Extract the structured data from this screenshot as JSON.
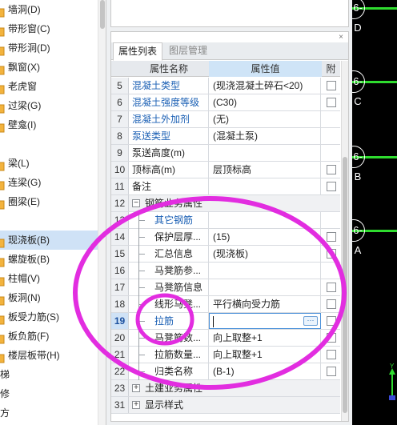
{
  "left_tree": {
    "items": [
      {
        "label": "墙洞(D)",
        "top_level": false,
        "selected": false
      },
      {
        "label": "带形窗(C)",
        "top_level": false,
        "selected": false
      },
      {
        "label": "带形洞(D)",
        "top_level": false,
        "selected": false
      },
      {
        "label": "飘窗(X)",
        "top_level": false,
        "selected": false
      },
      {
        "label": "老虎窗",
        "top_level": false,
        "selected": false
      },
      {
        "label": "过梁(G)",
        "top_level": false,
        "selected": false
      },
      {
        "label": "壁龛(I)",
        "top_level": false,
        "selected": false
      },
      {
        "label": "",
        "top_level": true,
        "selected": false
      },
      {
        "label": "梁(L)",
        "top_level": false,
        "selected": false
      },
      {
        "label": "连梁(G)",
        "top_level": false,
        "selected": false
      },
      {
        "label": "圈梁(E)",
        "top_level": false,
        "selected": false
      },
      {
        "label": "",
        "top_level": true,
        "selected": false
      },
      {
        "label": "现浇板(B)",
        "top_level": false,
        "selected": true
      },
      {
        "label": "螺旋板(B)",
        "top_level": false,
        "selected": false
      },
      {
        "label": "柱帽(V)",
        "top_level": false,
        "selected": false
      },
      {
        "label": "板洞(N)",
        "top_level": false,
        "selected": false
      },
      {
        "label": "板受力筋(S)",
        "top_level": false,
        "selected": false
      },
      {
        "label": "板负筋(F)",
        "top_level": false,
        "selected": false
      },
      {
        "label": "楼层板带(H)",
        "top_level": false,
        "selected": false
      },
      {
        "label": "梯",
        "top_level": true,
        "selected": false
      },
      {
        "label": "修",
        "top_level": true,
        "selected": false
      },
      {
        "label": "方",
        "top_level": true,
        "selected": false
      }
    ]
  },
  "panel": {
    "close_glyph": "×",
    "tabs": [
      {
        "label": "属性列表",
        "active": true
      },
      {
        "label": "图层管理",
        "active": false
      }
    ],
    "columns": {
      "name": "属性名称",
      "value": "属性值",
      "attach": "附"
    },
    "rows": [
      {
        "num": "5",
        "name": "混凝土类型",
        "value": "(现浇混凝土碎石<20)",
        "link": true,
        "check": true
      },
      {
        "num": "6",
        "name": "混凝土强度等级",
        "value": "(C30)",
        "link": true,
        "check": true
      },
      {
        "num": "7",
        "name": "混凝土外加剂",
        "value": "(无)",
        "link": true,
        "check": false
      },
      {
        "num": "8",
        "name": "泵送类型",
        "value": "(混凝土泵)",
        "link": true,
        "check": false
      },
      {
        "num": "9",
        "name": "泵送高度(m)",
        "value": "",
        "link": false,
        "check": false
      },
      {
        "num": "10",
        "name": "顶标高(m)",
        "value": "层顶标高",
        "link": false,
        "check": true
      },
      {
        "num": "11",
        "name": "备注",
        "value": "",
        "link": false,
        "check": true
      },
      {
        "num": "12",
        "name": "钢筋业务属性",
        "value": "",
        "group": true,
        "expander": "−",
        "check": false
      },
      {
        "num": "13",
        "name": "其它钢筋",
        "value": "",
        "link": true,
        "child": true,
        "check": false
      },
      {
        "num": "14",
        "name": "保护层厚...",
        "value": "(15)",
        "link": false,
        "child": true,
        "check": true
      },
      {
        "num": "15",
        "name": "汇总信息",
        "value": "(现浇板)",
        "link": false,
        "child": true,
        "check": true
      },
      {
        "num": "16",
        "name": "马凳筋参...",
        "value": "",
        "link": false,
        "child": true,
        "check": false
      },
      {
        "num": "17",
        "name": "马凳筋信息",
        "value": "",
        "link": false,
        "child": true,
        "check": true
      },
      {
        "num": "18",
        "name": "线形马凳...",
        "value": "平行横向受力筋",
        "link": false,
        "child": true,
        "check": true
      },
      {
        "num": "19",
        "name": "拉筋",
        "value": "",
        "link": true,
        "child": true,
        "check": true,
        "current": true,
        "editing": true,
        "more": "···"
      },
      {
        "num": "20",
        "name": "马凳筋数...",
        "value": "向上取整+1",
        "link": false,
        "child": true,
        "check": true
      },
      {
        "num": "21",
        "name": "拉筋数量...",
        "value": "向上取整+1",
        "link": false,
        "child": true,
        "check": true
      },
      {
        "num": "22",
        "name": "归类名称",
        "value": "(B-1)",
        "link": false,
        "child": true,
        "check": true
      },
      {
        "num": "23",
        "name": "土建业务属性",
        "value": "",
        "group": true,
        "expander": "+",
        "check": false
      },
      {
        "num": "31",
        "name": "显示样式",
        "value": "",
        "group": true,
        "expander": "+",
        "check": false
      }
    ]
  },
  "canvas": {
    "axis_labels": [
      "6-D",
      "6-C",
      "6-B",
      "6-A"
    ],
    "line_color": "#2fdc2f",
    "ucs_label": "Y"
  },
  "annotation": {
    "color": "#e22de0"
  }
}
